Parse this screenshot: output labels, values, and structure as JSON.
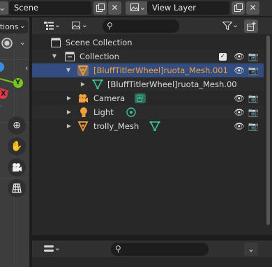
{
  "top_bar": {
    "scene_field": "Scene",
    "view_layer_field": "View Layer",
    "copy_icon": "copy-icon",
    "close_icon": "close-icon"
  },
  "viewport": {
    "mode_pill": "otions",
    "x_axis": "X",
    "y_axis": "Y",
    "tools": [
      "zoom-icon",
      "hand-icon",
      "camera-icon",
      "grid-icon"
    ]
  },
  "outliner": {
    "header": {
      "display_mode_icon": "list-icon",
      "view_icon": "image-icon",
      "search_icon": "search-icon",
      "filter_icon": "filter-icon",
      "new_collection_icon": "new-collection-icon"
    },
    "rows": [
      {
        "label": "Scene Collection",
        "depth": 0
      },
      {
        "label": "Collection",
        "depth": 1
      },
      {
        "label": "[BluffTitlerWheel]ruota_Mesh.001",
        "depth": 2,
        "selected": true
      },
      {
        "label": "[BluffTitlerWheel]ruota_Mesh.00",
        "depth": 3
      },
      {
        "label": "Camera",
        "depth": 2
      },
      {
        "label": "Light",
        "depth": 2
      },
      {
        "label": "trolly_Mesh",
        "depth": 2
      }
    ]
  },
  "props": {
    "editor_icon": "properties-icon",
    "search_icon": "search-icon"
  },
  "colors": {
    "selected_row": "#334d80",
    "active_label": "#f5a03a",
    "mesh_icon": "#f5a03a",
    "data_icon": "#3fc29a",
    "axis_y": "#78c51b",
    "axis_x": "#e0394d",
    "axis_z": "#3b8ce5"
  }
}
